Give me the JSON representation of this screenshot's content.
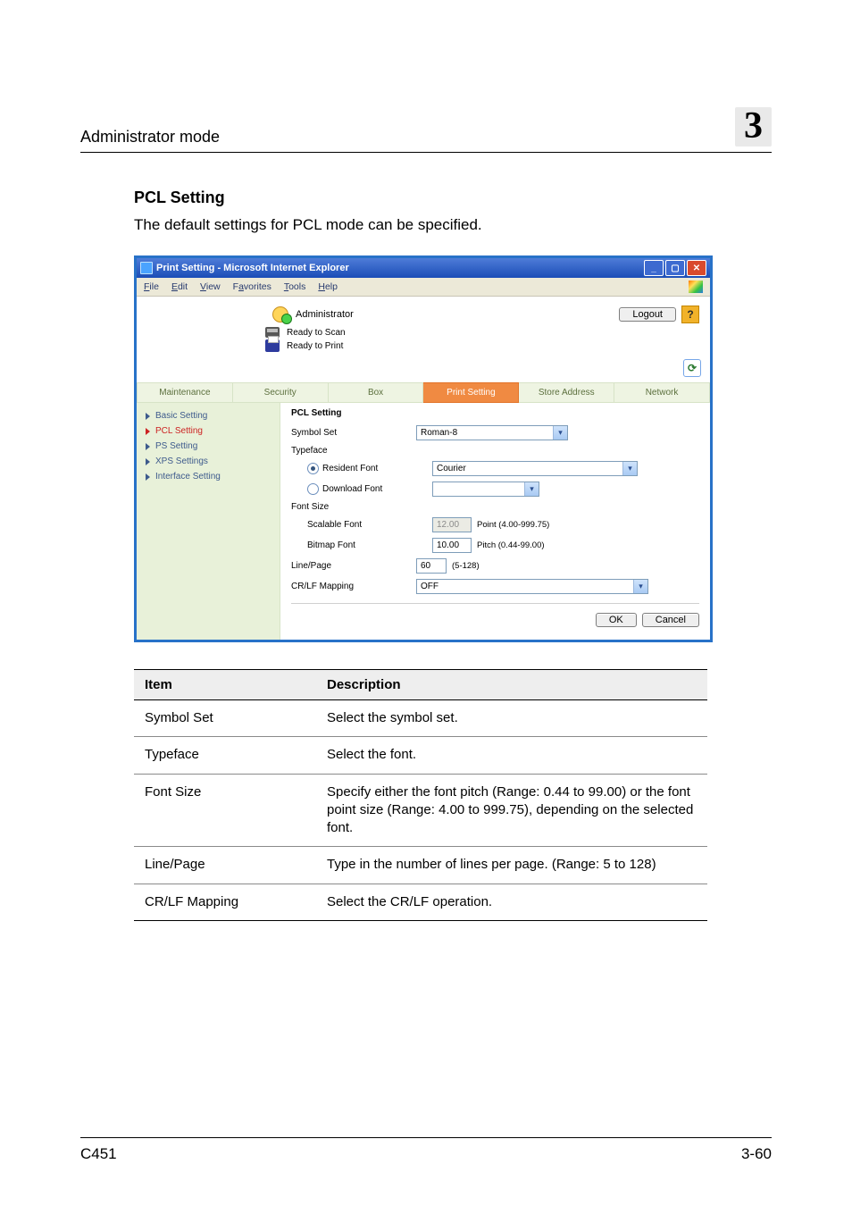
{
  "page": {
    "running_title": "Administrator mode",
    "chapter_number": "3",
    "section_heading": "PCL Setting",
    "lead_sentence": "The default settings for PCL mode can be specified.",
    "footer_left": "C451",
    "footer_right": "3-60"
  },
  "screenshot": {
    "window_title": "Print Setting - Microsoft Internet Explorer",
    "ie_menu": [
      "File",
      "Edit",
      "View",
      "Favorites",
      "Tools",
      "Help"
    ],
    "user_label": "Administrator",
    "logout": "Logout",
    "help_char": "?",
    "status": {
      "scan": "Ready to Scan",
      "print": "Ready to Print"
    },
    "refresh_glyph": "⟳",
    "tabs": [
      "Maintenance",
      "Security",
      "Box",
      "Print Setting",
      "Store Address",
      "Network"
    ],
    "tabs_active_index": 3,
    "side_menu": [
      "Basic Setting",
      "PCL Setting",
      "PS Setting",
      "XPS Settings",
      "Interface Setting"
    ],
    "side_menu_selected_index": 1,
    "panel": {
      "title": "PCL Setting",
      "rows": {
        "symbol_set_label": "Symbol Set",
        "symbol_set_value": "Roman-8",
        "typeface_label": "Typeface",
        "resident_font_label": "Resident Font",
        "resident_font_value": "Courier",
        "download_font_label": "Download Font",
        "download_font_value": "",
        "font_size_label": "Font Size",
        "scalable_label": "Scalable Font",
        "scalable_value": "12.00",
        "scalable_hint": "Point (4.00-999.75)",
        "bitmap_label": "Bitmap Font",
        "bitmap_value": "10.00",
        "bitmap_hint": "Pitch (0.44-99.00)",
        "linepage_label": "Line/Page",
        "linepage_value": "60",
        "linepage_hint": "(5-128)",
        "crlf_label": "CR/LF Mapping",
        "crlf_value": "OFF"
      },
      "buttons": {
        "ok": "OK",
        "cancel": "Cancel"
      }
    }
  },
  "table": {
    "head_item": "Item",
    "head_desc": "Description",
    "rows": [
      {
        "item": "Symbol Set",
        "desc": "Select the symbol set."
      },
      {
        "item": "Typeface",
        "desc": "Select the font."
      },
      {
        "item": "Font Size",
        "desc": "Specify either the font pitch (Range: 0.44 to 99.00) or the font point size (Range: 4.00 to 999.75), depending on the selected font."
      },
      {
        "item": "Line/Page",
        "desc": "Type in the number of lines per page. (Range: 5 to 128)"
      },
      {
        "item": "CR/LF Mapping",
        "desc": "Select the CR/LF operation."
      }
    ]
  }
}
